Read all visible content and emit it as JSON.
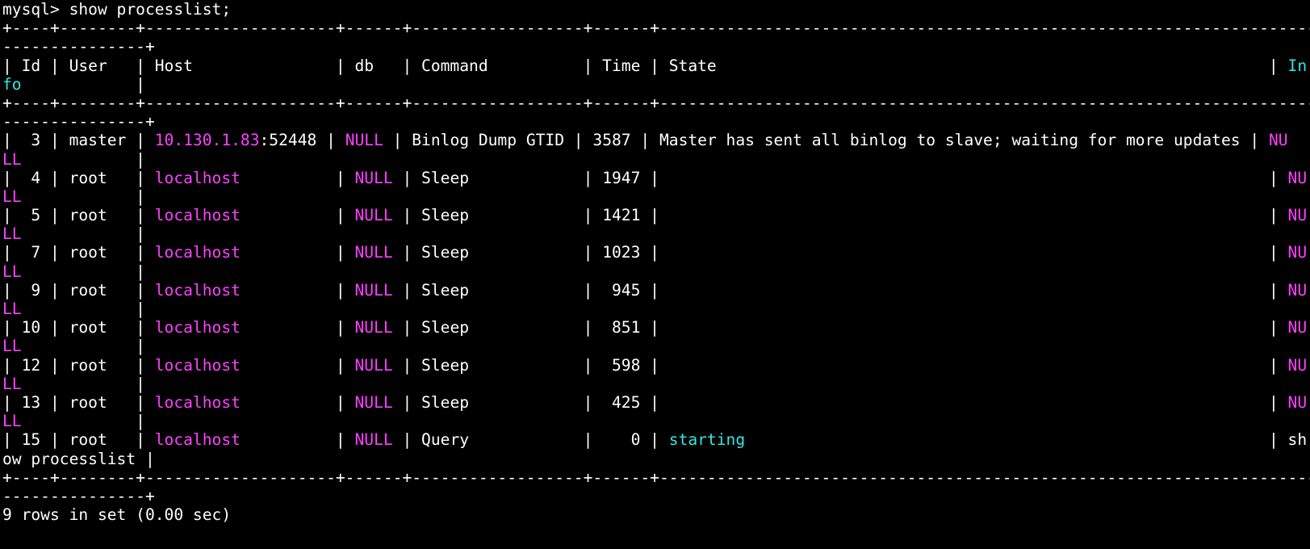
{
  "terminal": {
    "colors": {
      "background": "#000000",
      "text": "#ffffff",
      "highlight_value": "#ff40ff",
      "highlight_info": "#33e6e6"
    },
    "lines": [
      [
        {
          "t": "mysql> show processlist;",
          "c": "w"
        }
      ],
      [
        {
          "t": "+----+--------+--------------------+------+------------------+------+----------------------------------------------------------------------------------------------------------------------------",
          "c": "w"
        }
      ],
      [
        {
          "t": "---------------+",
          "c": "w"
        }
      ],
      [
        {
          "t": "| Id | User   | Host               | db   | Command          | Time | State                                                          | ",
          "c": "w"
        },
        {
          "t": "In",
          "c": "c"
        }
      ],
      [
        {
          "t": "fo",
          "c": "c"
        },
        {
          "t": "            |",
          "c": "w"
        }
      ],
      [
        {
          "t": "+----+--------+--------------------+------+------------------+------+----------------------------------------------------------------------------------------------------------------------------",
          "c": "w"
        }
      ],
      [
        {
          "t": "---------------+",
          "c": "w"
        }
      ],
      [
        {
          "t": "|  3 | master | ",
          "c": "w"
        },
        {
          "t": "10.130.1.83",
          "c": "m"
        },
        {
          "t": ":52448 | ",
          "c": "w"
        },
        {
          "t": "NULL",
          "c": "m"
        },
        {
          "t": " | Binlog Dump GTID | 3587 | Master has sent all binlog to slave; waiting for more updates | ",
          "c": "w"
        },
        {
          "t": "NU",
          "c": "m"
        }
      ],
      [
        {
          "t": "LL",
          "c": "m"
        },
        {
          "t": "            |",
          "c": "w"
        }
      ],
      [
        {
          "t": "|  4 | root   | ",
          "c": "w"
        },
        {
          "t": "localhost",
          "c": "m"
        },
        {
          "t": "          | ",
          "c": "w"
        },
        {
          "t": "NULL",
          "c": "m"
        },
        {
          "t": " | Sleep            | 1947 |                                                                | ",
          "c": "w"
        },
        {
          "t": "NU",
          "c": "m"
        }
      ],
      [
        {
          "t": "LL",
          "c": "m"
        },
        {
          "t": "            |",
          "c": "w"
        }
      ],
      [
        {
          "t": "|  5 | root   | ",
          "c": "w"
        },
        {
          "t": "localhost",
          "c": "m"
        },
        {
          "t": "          | ",
          "c": "w"
        },
        {
          "t": "NULL",
          "c": "m"
        },
        {
          "t": " | Sleep            | 1421 |                                                                | ",
          "c": "w"
        },
        {
          "t": "NU",
          "c": "m"
        }
      ],
      [
        {
          "t": "LL",
          "c": "m"
        },
        {
          "t": "            |",
          "c": "w"
        }
      ],
      [
        {
          "t": "|  7 | root   | ",
          "c": "w"
        },
        {
          "t": "localhost",
          "c": "m"
        },
        {
          "t": "          | ",
          "c": "w"
        },
        {
          "t": "NULL",
          "c": "m"
        },
        {
          "t": " | Sleep            | 1023 |                                                                | ",
          "c": "w"
        },
        {
          "t": "NU",
          "c": "m"
        }
      ],
      [
        {
          "t": "LL",
          "c": "m"
        },
        {
          "t": "            |",
          "c": "w"
        }
      ],
      [
        {
          "t": "|  9 | root   | ",
          "c": "w"
        },
        {
          "t": "localhost",
          "c": "m"
        },
        {
          "t": "          | ",
          "c": "w"
        },
        {
          "t": "NULL",
          "c": "m"
        },
        {
          "t": " | Sleep            |  945 |                                                                | ",
          "c": "w"
        },
        {
          "t": "NU",
          "c": "m"
        }
      ],
      [
        {
          "t": "LL",
          "c": "m"
        },
        {
          "t": "            |",
          "c": "w"
        }
      ],
      [
        {
          "t": "| 10 | root   | ",
          "c": "w"
        },
        {
          "t": "localhost",
          "c": "m"
        },
        {
          "t": "          | ",
          "c": "w"
        },
        {
          "t": "NULL",
          "c": "m"
        },
        {
          "t": " | Sleep            |  851 |                                                                | ",
          "c": "w"
        },
        {
          "t": "NU",
          "c": "m"
        }
      ],
      [
        {
          "t": "LL",
          "c": "m"
        },
        {
          "t": "            |",
          "c": "w"
        }
      ],
      [
        {
          "t": "| 12 | root   | ",
          "c": "w"
        },
        {
          "t": "localhost",
          "c": "m"
        },
        {
          "t": "          | ",
          "c": "w"
        },
        {
          "t": "NULL",
          "c": "m"
        },
        {
          "t": " | Sleep            |  598 |                                                                | ",
          "c": "w"
        },
        {
          "t": "NU",
          "c": "m"
        }
      ],
      [
        {
          "t": "LL",
          "c": "m"
        },
        {
          "t": "            |",
          "c": "w"
        }
      ],
      [
        {
          "t": "| 13 | root   | ",
          "c": "w"
        },
        {
          "t": "localhost",
          "c": "m"
        },
        {
          "t": "          | ",
          "c": "w"
        },
        {
          "t": "NULL",
          "c": "m"
        },
        {
          "t": " | Sleep            |  425 |                                                                | ",
          "c": "w"
        },
        {
          "t": "NU",
          "c": "m"
        }
      ],
      [
        {
          "t": "LL",
          "c": "m"
        },
        {
          "t": "            |",
          "c": "w"
        }
      ],
      [
        {
          "t": "| 15 | root   | ",
          "c": "w"
        },
        {
          "t": "localhost",
          "c": "m"
        },
        {
          "t": "          | ",
          "c": "w"
        },
        {
          "t": "NULL",
          "c": "m"
        },
        {
          "t": " | Query            |    0 | ",
          "c": "w"
        },
        {
          "t": "starting",
          "c": "c"
        },
        {
          "t": "                                                       | sh",
          "c": "w"
        }
      ],
      [
        {
          "t": "ow processlist |",
          "c": "w"
        }
      ],
      [
        {
          "t": "+----+--------+--------------------+------+------------------+------+----------------------------------------------------------------------------------------------------------------------------",
          "c": "w"
        }
      ],
      [
        {
          "t": "---------------+",
          "c": "w"
        }
      ],
      [
        {
          "t": "9 rows in set (0.00 sec)",
          "c": "w"
        }
      ]
    ]
  }
}
